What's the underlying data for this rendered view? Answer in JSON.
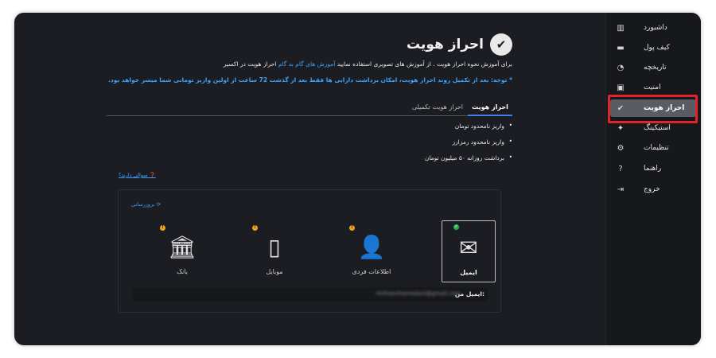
{
  "sidebar": {
    "items": [
      {
        "label": "داشبورد",
        "icon": "bar-chart-icon",
        "glyph": "▥"
      },
      {
        "label": "کیف پول",
        "icon": "wallet-icon",
        "glyph": "▬"
      },
      {
        "label": "تاریخچه",
        "icon": "history-icon",
        "glyph": "◔"
      },
      {
        "label": "امنیت",
        "icon": "lock-icon",
        "glyph": "▣"
      },
      {
        "label": "احراز هویت",
        "icon": "check-circle-icon",
        "glyph": "✔"
      },
      {
        "label": "استیکینگ",
        "icon": "staking-icon",
        "glyph": "✦"
      },
      {
        "label": "تنظیمات",
        "icon": "gear-icon",
        "glyph": "⚙"
      },
      {
        "label": "راهنما",
        "icon": "help-icon",
        "glyph": "?"
      },
      {
        "label": "خروج",
        "icon": "logout-icon",
        "glyph": "⇥"
      }
    ],
    "active_index": 4
  },
  "page": {
    "title": "احراز هویت",
    "intro_prefix": "برای آموزش نحوه احراز هویت . از آموزش های تصویری استفاده نمایید",
    "intro_link": "آموزش های گام به گام",
    "intro_suffix": "احراز هویت در اکسیر",
    "note": "* توجه: بعد از تکمیل روند احراز هویت، امکان برداشت دارایی ها فقط بعد از گذشت 72 ساعت از اولین واریز تومانی شما میسر خواهد بود.",
    "tabs": [
      {
        "label": "احراز هویت"
      },
      {
        "label": "احراز هویت تکمیلی"
      }
    ],
    "bullets": [
      "واریز نامحدود تومان",
      "واریز نامحدود رمزارز",
      "برداشت روزانه ۵۰ میلیون تومان"
    ],
    "guide_link": "سوالی دارید؟",
    "refresh_label": "بروزرسانی ⟳",
    "methods": [
      {
        "label": "ایمیل",
        "icon": "envelope-icon",
        "glyph": "✉",
        "status": "verified"
      },
      {
        "label": "اطلاعات فردی",
        "icon": "person-icon",
        "glyph": "👤",
        "status": "pending"
      },
      {
        "label": "موبایل",
        "icon": "mobile-phone-icon",
        "glyph": "▯",
        "status": "pending"
      },
      {
        "label": "بانک",
        "icon": "bank-icon",
        "glyph": "🏛",
        "status": "pending"
      }
    ],
    "email_label": "ایمیل من:",
    "email_value": "mohsenhamedani@gmail.com"
  },
  "colors": {
    "background": "#1c1d22",
    "sidebar": "#17181c",
    "accent_blue": "#3aa3ff",
    "tab_underline": "#3f7de8",
    "highlight_red": "#e2232a",
    "warning": "#f0a21b",
    "success": "#29b34a"
  }
}
